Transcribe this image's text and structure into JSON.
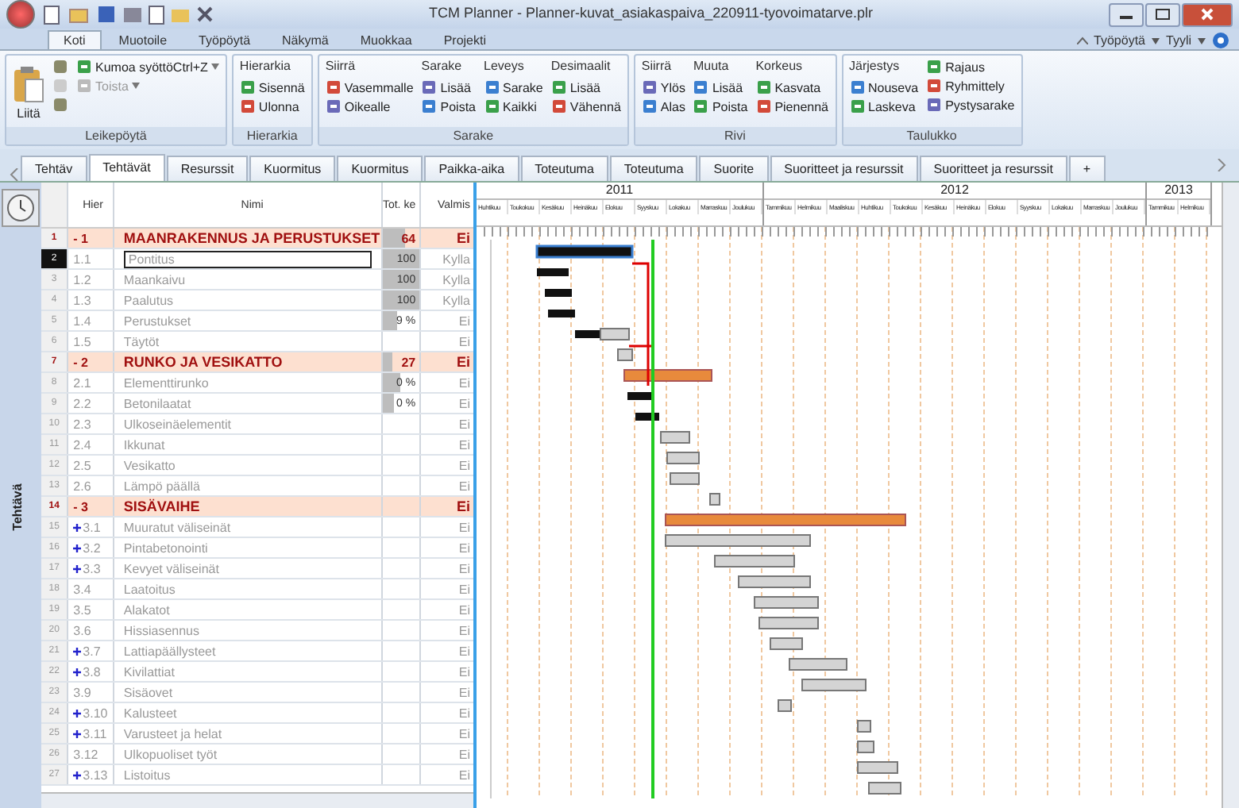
{
  "window": {
    "title": "TCM Planner - Planner-kuvat_asiakaspaiva_220911-tyovoimatarve.plr"
  },
  "ribbon_tabs": [
    {
      "label": "Koti",
      "selected": true
    },
    {
      "label": "Muotoile",
      "selected": false
    },
    {
      "label": "Työpöytä",
      "selected": false
    },
    {
      "label": "Näkymä",
      "selected": false
    },
    {
      "label": "Muokkaa",
      "selected": false
    },
    {
      "label": "Projekti",
      "selected": false
    }
  ],
  "ribbon_right": [
    {
      "label": "Työpöytä"
    },
    {
      "label": "Tyyli"
    }
  ],
  "ribbon_groups": [
    {
      "title": "Leikepöytä",
      "big": {
        "label": "Liitä"
      },
      "columns": [
        {
          "items": [
            {
              "disabled": false
            },
            {
              "disabled": true
            },
            {
              "disabled": false
            }
          ]
        },
        {
          "items": [
            {
              "label": "Kumoa syöttöCtrl+Z",
              "disabled": false,
              "dropdown": true
            },
            {
              "label": "Toista",
              "disabled": true,
              "dropdown": true
            }
          ]
        }
      ]
    },
    {
      "title": "Hierarkia",
      "columns": [
        {
          "heading": "Hierarkia",
          "items": [
            {
              "label": "Sisennä",
              "disabled": false
            },
            {
              "label": "Ulonna",
              "disabled": false
            }
          ]
        }
      ]
    },
    {
      "title": "Sarake",
      "columns": [
        {
          "heading": "Siirrä",
          "items": [
            {
              "label": "Vasemmalle",
              "disabled": false
            },
            {
              "label": "Oikealle",
              "disabled": false
            }
          ]
        },
        {
          "heading": "Sarake",
          "items": [
            {
              "label": "Lisää",
              "disabled": false
            },
            {
              "label": "Poista",
              "disabled": false
            }
          ]
        },
        {
          "heading": "Leveys",
          "items": [
            {
              "label": "Sarake",
              "disabled": false
            },
            {
              "label": "Kaikki",
              "disabled": false
            }
          ]
        },
        {
          "heading": "Desimaalit",
          "items": [
            {
              "label": "Lisää",
              "disabled": false
            },
            {
              "label": "Vähennä",
              "disabled": false
            }
          ]
        }
      ]
    },
    {
      "title": "Rivi",
      "columns": [
        {
          "heading": "Siirrä",
          "items": [
            {
              "label": "Ylös",
              "disabled": false
            },
            {
              "label": "Alas",
              "disabled": false
            }
          ]
        },
        {
          "heading": "Muuta",
          "items": [
            {
              "label": "Lisää",
              "disabled": false
            },
            {
              "label": "Poista",
              "disabled": false
            }
          ]
        },
        {
          "heading": "Korkeus",
          "items": [
            {
              "label": "Kasvata",
              "disabled": false
            },
            {
              "label": "Pienennä",
              "disabled": false
            }
          ]
        }
      ]
    },
    {
      "title": "Taulukko",
      "columns": [
        {
          "heading": "Järjestys",
          "items": [
            {
              "label": "Nouseva",
              "disabled": false
            },
            {
              "label": "Laskeva",
              "disabled": false
            }
          ]
        },
        {
          "items": [
            {
              "label": "Rajaus",
              "disabled": false
            },
            {
              "label": "Ryhmittely",
              "disabled": false
            },
            {
              "label": "Pystysarake",
              "disabled": false
            }
          ]
        }
      ]
    }
  ],
  "view_tabs": [
    {
      "label": "Tehtäv",
      "selected": false
    },
    {
      "label": "Tehtävät",
      "selected": true
    },
    {
      "label": "Resurssit",
      "selected": false
    },
    {
      "label": "Kuormitus",
      "selected": false
    },
    {
      "label": "Kuormitus",
      "selected": false
    },
    {
      "label": "Paikka-aika",
      "selected": false
    },
    {
      "label": "Toteutuma",
      "selected": false
    },
    {
      "label": "Toteutuma",
      "selected": false
    },
    {
      "label": "Suorite",
      "selected": false
    },
    {
      "label": "Suoritteet ja resurssit",
      "selected": false
    },
    {
      "label": "Suoritteet ja resurssit",
      "selected": false
    },
    {
      "label": "+",
      "selected": false
    }
  ],
  "side_label": "Tehtävä",
  "table": {
    "columns": [
      "Hier",
      "Nimi",
      "Tot. ke",
      "Valmis"
    ],
    "rows": [
      {
        "num": "1",
        "hier": "- 1",
        "name": "MAANRAKENNUS JA PERUSTUKSET",
        "tot": "64",
        "level": 0.64,
        "valmis": "Ei",
        "kind": "summary",
        "selected": false,
        "collapsed": false
      },
      {
        "num": "2",
        "hier": "1.1",
        "name": "Pontitus",
        "tot": "100",
        "level": 1,
        "valmis": "Kylla",
        "kind": "task",
        "selected": true,
        "collapsed": false
      },
      {
        "num": "3",
        "hier": "1.2",
        "name": "Maankaivu",
        "tot": "100",
        "level": 1,
        "valmis": "Kylla",
        "kind": "task",
        "selected": false,
        "collapsed": false
      },
      {
        "num": "4",
        "hier": "1.3",
        "name": "Paalutus",
        "tot": "100",
        "level": 1,
        "valmis": "Kylla",
        "kind": "task",
        "selected": false,
        "collapsed": false
      },
      {
        "num": "5",
        "hier": "1.4",
        "name": "Perustukset",
        "tot": "9 %",
        "level": 0.4,
        "valmis": "Ei",
        "kind": "task",
        "selected": false,
        "collapsed": false
      },
      {
        "num": "6",
        "hier": "1.5",
        "name": "Täytöt",
        "valmis": "Ei",
        "kind": "task",
        "selected": false,
        "collapsed": false
      },
      {
        "num": "7",
        "hier": "- 2",
        "name": "RUNKO JA VESIKATTO",
        "tot": "27",
        "level": 0.27,
        "valmis": "Ei",
        "kind": "summary",
        "selected": false,
        "collapsed": false
      },
      {
        "num": "8",
        "hier": "2.1",
        "name": "Elementtirunko",
        "tot": "0 %",
        "level": 0.5,
        "valmis": "Ei",
        "kind": "task",
        "selected": false,
        "collapsed": false
      },
      {
        "num": "9",
        "hier": "2.2",
        "name": "Betonilaatat",
        "tot": "0 %",
        "level": 0.3,
        "valmis": "Ei",
        "kind": "task",
        "selected": false,
        "collapsed": false
      },
      {
        "num": "10",
        "hier": "2.3",
        "name": "Ulkoseinäelementit",
        "valmis": "Ei",
        "kind": "task",
        "selected": false,
        "collapsed": false
      },
      {
        "num": "11",
        "hier": "2.4",
        "name": "Ikkunat",
        "valmis": "Ei",
        "kind": "task",
        "selected": false,
        "collapsed": false
      },
      {
        "num": "12",
        "hier": "2.5",
        "name": "Vesikatto",
        "valmis": "Ei",
        "kind": "task",
        "selected": false,
        "collapsed": false
      },
      {
        "num": "13",
        "hier": "2.6",
        "name": "Lämpö päällä",
        "valmis": "Ei",
        "kind": "task",
        "selected": false,
        "collapsed": false
      },
      {
        "num": "14",
        "hier": "- 3",
        "name": "SISÄVAIHE",
        "valmis": "Ei",
        "kind": "summary",
        "selected": false,
        "collapsed": false
      },
      {
        "num": "15",
        "hier": "3.1",
        "name": "Muuratut väliseinät",
        "valmis": "Ei",
        "kind": "task",
        "selected": false,
        "collapsed": true
      },
      {
        "num": "16",
        "hier": "3.2",
        "name": "Pintabetonointi",
        "valmis": "Ei",
        "kind": "task",
        "selected": false,
        "collapsed": true
      },
      {
        "num": "17",
        "hier": "3.3",
        "name": "Kevyet väliseinät",
        "valmis": "Ei",
        "kind": "task",
        "selected": false,
        "collapsed": true
      },
      {
        "num": "18",
        "hier": "3.4",
        "name": "Laatoitus",
        "valmis": "Ei",
        "kind": "task",
        "selected": false,
        "collapsed": false
      },
      {
        "num": "19",
        "hier": "3.5",
        "name": "Alakatot",
        "valmis": "Ei",
        "kind": "task",
        "selected": false,
        "collapsed": false
      },
      {
        "num": "20",
        "hier": "3.6",
        "name": "Hissiasennus",
        "valmis": "Ei",
        "kind": "task",
        "selected": false,
        "collapsed": false
      },
      {
        "num": "21",
        "hier": "3.7",
        "name": "Lattiapäällysteet",
        "valmis": "Ei",
        "kind": "task",
        "selected": false,
        "collapsed": true
      },
      {
        "num": "22",
        "hier": "3.8",
        "name": "Kivilattiat",
        "valmis": "Ei",
        "kind": "task",
        "selected": false,
        "collapsed": true
      },
      {
        "num": "23",
        "hier": "3.9",
        "name": "Sisäovet",
        "valmis": "Ei",
        "kind": "task",
        "selected": false,
        "collapsed": false
      },
      {
        "num": "24",
        "hier": "3.10",
        "name": "Kalusteet",
        "valmis": "Ei",
        "kind": "task",
        "selected": false,
        "collapsed": true
      },
      {
        "num": "25",
        "hier": "3.11",
        "name": "Varusteet ja helat",
        "valmis": "Ei",
        "kind": "task",
        "selected": false,
        "collapsed": true
      },
      {
        "num": "26",
        "hier": "3.12",
        "name": "Ulkopuoliset työt",
        "valmis": "Ei",
        "kind": "task",
        "selected": false,
        "collapsed": false
      },
      {
        "num": "27",
        "hier": "3.13",
        "name": "Listoitus",
        "valmis": "Ei",
        "kind": "task",
        "selected": false,
        "collapsed": true
      }
    ]
  },
  "timeline": {
    "years": [
      {
        "label": "2011",
        "months": [
          "Huhtikuu",
          "Toukokuu",
          "Kesäkuu",
          "Heinäkuu",
          "Elokuu",
          "Syyskuu",
          "Lokakuu",
          "Marraskuu",
          "Joulukuu"
        ]
      },
      {
        "label": "2012",
        "months": [
          "Tammikuu",
          "Helmikuu",
          "Maaliskuu",
          "Huhtikuu",
          "Toukokuu",
          "Kesäkuu",
          "Heinäkuu",
          "Elokuu",
          "Syyskuu",
          "Lokakuu",
          "Marraskuu",
          "Joulukuu"
        ]
      },
      {
        "label": "2013",
        "months": [
          "Tammikuu",
          "Helmikuu"
        ]
      }
    ]
  }
}
